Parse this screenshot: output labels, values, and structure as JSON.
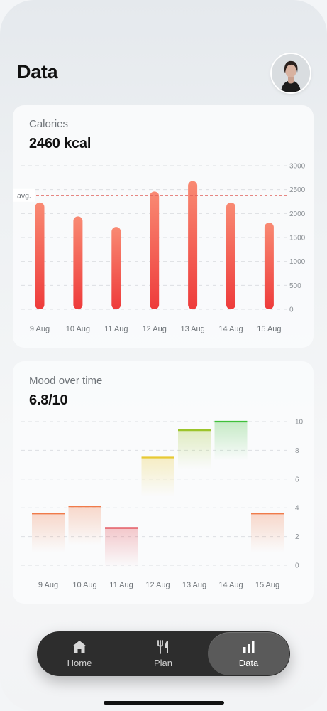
{
  "header": {
    "title": "Data"
  },
  "calories": {
    "title": "Calories",
    "value": "2460 kcal",
    "avg_label": "avg.",
    "chart_data": {
      "type": "bar",
      "categories": [
        "9 Aug",
        "10 Aug",
        "11 Aug",
        "12 Aug",
        "13 Aug",
        "14 Aug",
        "15 Aug"
      ],
      "values": [
        2230,
        1940,
        1720,
        2460,
        2680,
        2230,
        1810
      ],
      "average": 2380,
      "ylim": [
        0,
        3000
      ],
      "yticks": [
        0,
        500,
        1000,
        1500,
        2000,
        2500,
        3000
      ],
      "grid": true,
      "bar_color": "#f0463c"
    }
  },
  "mood": {
    "title": "Mood over time",
    "value": "6.8/10",
    "chart_data": {
      "type": "bar",
      "categories": [
        "9 Aug",
        "10 Aug",
        "11 Aug",
        "12 Aug",
        "13 Aug",
        "14 Aug",
        "15 Aug"
      ],
      "values": [
        3.6,
        4.1,
        2.6,
        7.5,
        9.4,
        10,
        3.6
      ],
      "present": [
        true,
        true,
        true,
        true,
        true,
        true,
        true
      ],
      "colors": [
        "#f07b4a",
        "#f07b4a",
        "#e0414b",
        "#e8c934",
        "#9cc42a",
        "#3fbf3a",
        "#f07b4a"
      ],
      "ylim": [
        0,
        10
      ],
      "yticks": [
        0,
        2,
        4,
        6,
        8,
        10
      ],
      "grid": true
    }
  },
  "nav": {
    "items": [
      {
        "label": "Home",
        "icon": "home-icon"
      },
      {
        "label": "Plan",
        "icon": "fork-knife-icon"
      },
      {
        "label": "Data",
        "icon": "bar-chart-icon"
      }
    ],
    "active": "Data"
  }
}
